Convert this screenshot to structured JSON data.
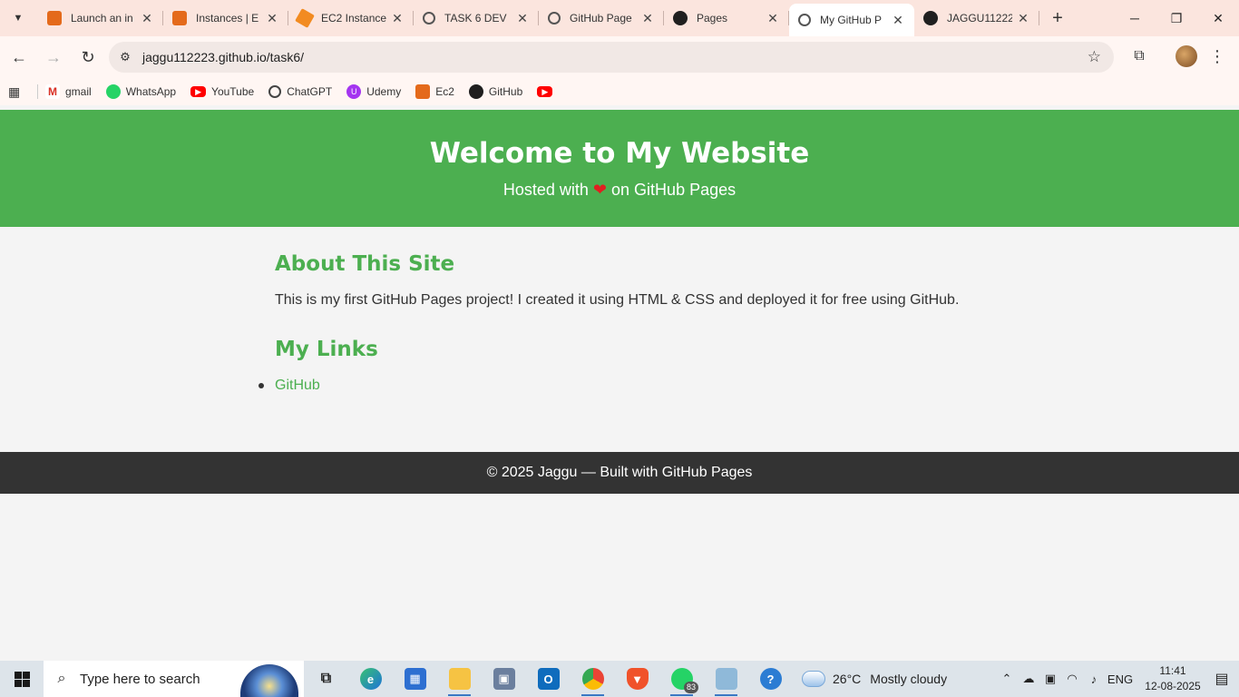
{
  "browser": {
    "tabs": [
      {
        "title": "Launch an in",
        "favicon": "aws-icon",
        "active": false
      },
      {
        "title": "Instances | E",
        "favicon": "aws-icon",
        "active": false
      },
      {
        "title": "EC2 Instance",
        "favicon": "ec2-icon",
        "active": false
      },
      {
        "title": "TASK 6 DEV",
        "favicon": "globe-icon",
        "active": false
      },
      {
        "title": "GitHub Page",
        "favicon": "chatgpt-icon",
        "active": false
      },
      {
        "title": "Pages",
        "favicon": "github-icon",
        "active": false
      },
      {
        "title": "My GitHub P",
        "favicon": "globe-icon",
        "active": true
      },
      {
        "title": "JAGGU11222",
        "favicon": "github-icon",
        "active": false
      }
    ],
    "url": "jaggu112223.github.io/task6/",
    "bookmarks": [
      {
        "label": "gmail",
        "icon": "gmail-icon"
      },
      {
        "label": "WhatsApp",
        "icon": "whatsapp-icon"
      },
      {
        "label": "YouTube",
        "icon": "youtube-icon"
      },
      {
        "label": "ChatGPT",
        "icon": "chatgpt-icon"
      },
      {
        "label": "Udemy",
        "icon": "udemy-icon"
      },
      {
        "label": "Ec2",
        "icon": "aws-icon"
      },
      {
        "label": "GitHub",
        "icon": "github-icon"
      },
      {
        "label": "",
        "icon": "youtube-icon"
      }
    ]
  },
  "page": {
    "hero": {
      "title": "Welcome to My Website",
      "subtitle_before": "Hosted with",
      "heart": "❤",
      "subtitle_after": "on GitHub Pages"
    },
    "about": {
      "heading": "About This Site",
      "text": "This is my first GitHub Pages project! I created it using HTML & CSS and deployed it for free using GitHub."
    },
    "links": {
      "heading": "My Links",
      "items": [
        "GitHub"
      ]
    },
    "footer": "© 2025 Jaggu — Built with GitHub Pages",
    "accent_color": "#4caf50",
    "footer_color": "#333333"
  },
  "taskbar": {
    "search_placeholder": "Type here to search",
    "whatsapp_badge": "83",
    "weather": {
      "temp": "26°C",
      "condition": "Mostly cloudy"
    },
    "language": "ENG",
    "time": "11:41",
    "date": "12-08-2025"
  }
}
